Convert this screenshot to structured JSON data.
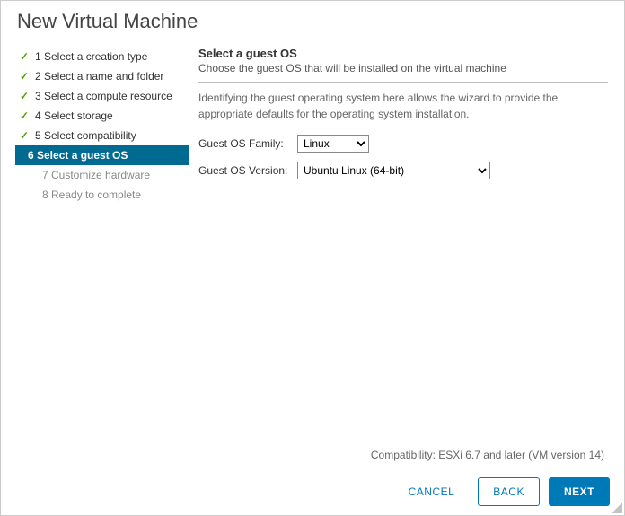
{
  "dialog_title": "New Virtual Machine",
  "sidebar": {
    "steps": [
      {
        "label": "1 Select a creation type",
        "state": "completed"
      },
      {
        "label": "2 Select a name and folder",
        "state": "completed"
      },
      {
        "label": "3 Select a compute resource",
        "state": "completed"
      },
      {
        "label": "4 Select storage",
        "state": "completed"
      },
      {
        "label": "5 Select compatibility",
        "state": "completed"
      },
      {
        "label": "6 Select a guest OS",
        "state": "active"
      },
      {
        "label": "7 Customize hardware",
        "state": "pending"
      },
      {
        "label": "8 Ready to complete",
        "state": "pending"
      }
    ]
  },
  "main": {
    "title": "Select a guest OS",
    "subtitle": "Choose the guest OS that will be installed on the virtual machine",
    "description": "Identifying the guest operating system here allows the wizard to provide the appropriate defaults for the operating system installation.",
    "fields": {
      "family": {
        "label": "Guest OS Family:",
        "value": "Linux"
      },
      "version": {
        "label": "Guest OS Version:",
        "value": "Ubuntu Linux (64-bit)"
      }
    },
    "compatibility": "Compatibility: ESXi 6.7 and later (VM version 14)"
  },
  "footer": {
    "cancel": "CANCEL",
    "back": "BACK",
    "next": "NEXT"
  }
}
